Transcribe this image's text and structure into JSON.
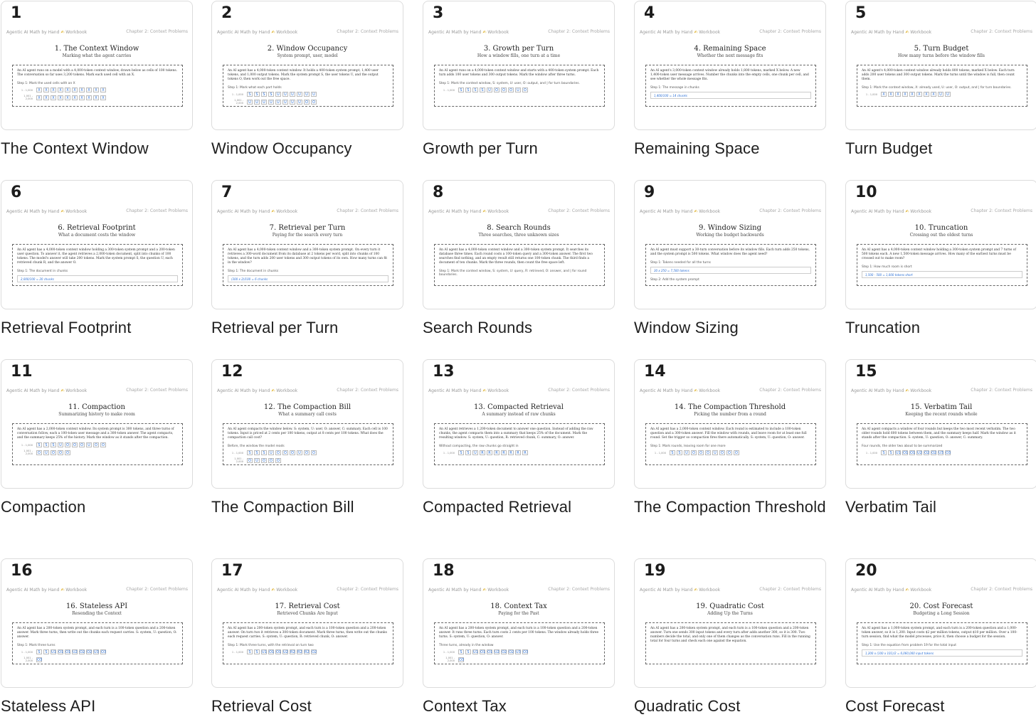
{
  "page_header": {
    "left": "Agentic AI Math by Hand",
    "pen": "✍",
    "workbook": "Workbook",
    "right": "Chapter 2: Context Problems"
  },
  "cards": [
    {
      "num": "1",
      "label": "The Context Window",
      "title": "1. The Context Window",
      "subtitle": "Marking what the agent carries",
      "text": "An AI agent runs on a model with a 4,000-token context window, drawn below as cells of 100 tokens. The conversation so far uses 3,200 tokens. Mark each used cell with an X.",
      "step": "Step 1: Mark the used cells with an X",
      "rows": [
        {
          "r": "1 - 1,000",
          "cells": [
            "X",
            "X",
            "X",
            "X",
            "X",
            "X",
            "X",
            "X",
            "X",
            "X"
          ]
        },
        {
          "r": "1,001 - 2,000",
          "cells": [
            "X",
            "X",
            "X",
            "X",
            "X",
            "X",
            "X",
            "X",
            "X",
            "X"
          ]
        }
      ],
      "answer": ""
    },
    {
      "num": "2",
      "label": "Window Occupancy",
      "title": "2. Window Occupancy",
      "subtitle": "System prompt, user, model",
      "text": "An AI agent has a 4,000-token context window. It holds a 400-token system prompt, 1,400 user tokens, and 1,000 output tokens. Mark the system prompt S, the user tokens U, and the output tokens O, then work out the free space.",
      "step": "Step 1: Mark what each part holds",
      "rows": [
        {
          "r": "1 - 1,000",
          "cells": [
            "S",
            "S",
            "S",
            "S",
            "U",
            "U",
            "U",
            "U",
            "U",
            "U"
          ]
        },
        {
          "r": "1,001 - 2,000",
          "cells": [
            "U",
            "U",
            "U",
            "U",
            "U",
            "U",
            "U",
            "U",
            "O",
            "O"
          ]
        }
      ],
      "answer": ""
    },
    {
      "num": "3",
      "label": "Growth per Turn",
      "title": "3. Growth per Turn",
      "subtitle": "How a window fills, one turn at a time",
      "text": "An AI agent runs on a 4,000-token context window and starts with a 400-token system prompt. Each turn adds 100 user tokens and 300 output tokens. Mark the window after three turns.",
      "step": "Step 1: Mark the context window, S: system, U: user, O: output, and | for turn boundaries.",
      "rows": [
        {
          "r": "1 - 1,000",
          "cells": [
            "S",
            "S",
            "S",
            "S",
            "U",
            "O",
            "O",
            "O",
            "U",
            "O"
          ]
        }
      ],
      "answer": ""
    },
    {
      "num": "4",
      "label": "Remaining Space",
      "title": "4. Remaining Space",
      "subtitle": "Whether the next message fits",
      "text": "An AI agent's 3,000-token context window already holds 1,800 tokens, marked X below. A new 1,400-token user message arrives. Number the chunks into the empty cells, one chunk per cell, and see whether the whole message fits.",
      "step": "Step 1: The message in chunks",
      "rows": [],
      "answer": "1,400/100 = 14 chunks"
    },
    {
      "num": "5",
      "label": "Turn Budget",
      "title": "5. Turn Budget",
      "subtitle": "How many turns before the window fills",
      "text": "An AI agent's 4,000-token context window already holds 800 tokens, marked X below. Each turn adds 200 user tokens and 300 output tokens. Mark the turns until the window is full, then count them.",
      "step": "Step 1: Mark the context window, X: already used, U: user, O: output, and | for turn boundaries.",
      "rows": [
        {
          "r": "1 - 1,000",
          "cells": [
            "X",
            "X",
            "X",
            "X",
            "X",
            "X",
            "X",
            "X",
            "U",
            "U"
          ]
        }
      ],
      "answer": ""
    },
    {
      "num": "6",
      "label": "Retrieval Footprint",
      "title": "6. Retrieval Footprint",
      "subtitle": "What a document costs the window",
      "text": "An AI agent has a 4,000-token context window holding a 300-token system prompt and a 200-token user question. To answer it, the agent retrieves a 2,000-token document, split into chunks of 100 tokens. The model's answer will take 200 tokens. Mark the system prompt S, the question U, each retrieved chunk R, and the answer O.",
      "step": "Step 1: The document in chunks",
      "rows": [],
      "answer": "2,000/100 = 20 chunks"
    },
    {
      "num": "7",
      "label": "Retrieval per Turn",
      "title": "7. Retrieval per Turn",
      "subtitle": "Paying for the search every turn",
      "text": "An AI agent has a 4,000-token context window and a 300-token system prompt. On every turn it retrieves a 300-word document from its database at 2 tokens per word, split into chunks of 100 tokens, and the turn adds 200 user tokens and 300 output tokens of its own. How many turns can fit in the window?",
      "step": "Step 1: The document in chunks",
      "rows": [],
      "answer": "(300 x 2)/100 = 6 chunks"
    },
    {
      "num": "8",
      "label": "Search Rounds",
      "title": "8. Search Rounds",
      "subtitle": "Three searches, three unknown sizes",
      "text": "An AI agent has a 4,000-token context window and a 300-token system prompt. It searches its database three times. Each round costs a 100-token query and a 300-token answer. The first two searches find nothing, and an empty result still returns one 100-token chunk. The third finds a document of ten chunks. Mark the three rounds, then count the free space left.",
      "step": "Step 1: Mark the context window, S: system, U: query, R: retrieved, O: answer, and | for round boundaries.",
      "rows": [],
      "answer": ""
    },
    {
      "num": "9",
      "label": "Window Sizing",
      "title": "9. Window Sizing",
      "subtitle": "Working the budget backwards",
      "text": "An AI agent must support a 30-turn conversation before its window fills. Each turn adds 250 tokens, and the system prompt is 500 tokens. What window does the agent need?",
      "step": "Step 1: Tokens needed for all the turns",
      "rows": [],
      "answer": "30 x 250 = 7,500 tokens",
      "step2": "Step 2: Add the system prompt"
    },
    {
      "num": "10",
      "label": "Truncation",
      "title": "10. Truncation",
      "subtitle": "Crossing out the oldest turns",
      "text": "An AI agent has a 4,000-token context window holding a 300-token system prompt and 7 turns of 500 tokens each. A new 1,500-token message arrives. How many of the earliest turns must be crossed out to make room?",
      "step": "Step 1: How much room is short",
      "rows": [],
      "answer": "1,500 - 500 = 1,000 tokens short"
    },
    {
      "num": "11",
      "label": "Compaction",
      "title": "11. Compaction",
      "subtitle": "Summarizing history to make room",
      "text": "An AI agent has a 2,000-token context window. Its system prompt is 300 tokens, and three turns of conversation follow, each a 100-token user message and a 300-token answer. The agent compacts, and the summary keeps 25% of the history. Mark the window as it stands after the compaction.",
      "step": "",
      "rows": [
        {
          "r": "1 - 1,000",
          "cells": [
            "S",
            "S",
            "S",
            "U",
            "O",
            "O",
            "O",
            "U",
            "O",
            "O"
          ]
        },
        {
          "r": "1,001 - 2,000",
          "cells": [
            "O",
            "U",
            "O",
            "O",
            "O"
          ]
        }
      ],
      "answer": ""
    },
    {
      "num": "12",
      "label": "The Compaction Bill",
      "title": "12. The Compaction Bill",
      "subtitle": "What a summary call costs",
      "text": "An AI agent compacts the window below. S: system, U: user, O: answer, C: summary. Each cell is 100 tokens. Input is priced at 2 cents per 100 tokens, output at 8 cents per 100 tokens. What does the compaction call cost?",
      "step": "Before, the window the model reads",
      "rows": [
        {
          "r": "1 - 1,000",
          "cells": [
            "S",
            "S",
            "S",
            "U",
            "O",
            "O",
            "O",
            "U",
            "O",
            "O"
          ]
        },
        {
          "r": "1,001 - 2,000",
          "cells": [
            "O",
            "U",
            "O",
            "O",
            "O"
          ]
        }
      ],
      "answer": ""
    },
    {
      "num": "13",
      "label": "Compacted Retrieval",
      "title": "13. Compacted Retrieval",
      "subtitle": "A summary instead of raw chunks",
      "text": "An AI agent retrieves a 1,200-token document to answer one question. Instead of adding the raw chunks, the agent compacts them into a summary that keeps 25% of the document. Mark the resulting window. S: system, U: question, R: retrieved chunk, C: summary, O: answer.",
      "step": "Without compacting, the raw chunks go straight in",
      "rows": [
        {
          "r": "1 - 1,000",
          "cells": [
            "S",
            "S",
            "U",
            "R",
            "R",
            "R",
            "R",
            "R",
            "R",
            "R"
          ]
        }
      ],
      "answer": ""
    },
    {
      "num": "14",
      "label": "The Compaction Threshold",
      "title": "14. The Compaction Threshold",
      "subtitle": "Picking the number from a round",
      "text": "An AI agent has a 2,000-token context window. Each round is estimated to include a 100-token question and a 300-token answer. Fill the window with rounds, and leave room for at least one full round. Set the trigger so compaction fires there automatically. S: system, U: question, O: answer.",
      "step": "Step 1: Mark rounds, leaving room for one more",
      "rows": [
        {
          "r": "1 - 1,000",
          "cells": [
            "S",
            "S",
            "U",
            "O",
            "O",
            "O",
            "U",
            "O",
            "O",
            "O"
          ]
        }
      ],
      "answer": ""
    },
    {
      "num": "15",
      "label": "Verbatim Tail",
      "title": "15. Verbatim Tail",
      "subtitle": "Keeping the recent rounds whole",
      "text": "An AI agent compacts a window of four rounds but keeps the two most recent verbatim. The two older rounds hold 600 tokens between them, and the summary keeps half. Mark the window as it stands after the compaction. S: system, U: question, O: answer, C: summary.",
      "step": "Four rounds, the older two about to be summarized",
      "rows": [
        {
          "r": "1 - 1,000",
          "cells": [
            "S",
            "S",
            "U1",
            "O1",
            "O1",
            "U2",
            "O2",
            "O2",
            "U3",
            "O3"
          ]
        }
      ],
      "answer": ""
    },
    {
      "num": "16",
      "label": "Stateless API",
      "title": "16. Stateless API",
      "subtitle": "Resending the Context",
      "text": "An AI agent has a 200-token system prompt, and each turn is a 100-token question and a 200-token answer. Mark three turns, then write out the chunks each request carries. S: system, U: question, O: answer.",
      "step": "Step 1: Mark three turns",
      "rows": [
        {
          "r": "1 - 1,000",
          "cells": [
            "S",
            "S",
            "U1",
            "O1",
            "O1",
            "U2",
            "O2",
            "O2",
            "U3",
            "O3"
          ]
        },
        {
          "r": "1,001 - 2,000",
          "cells": [
            "O3"
          ]
        }
      ],
      "answer": ""
    },
    {
      "num": "17",
      "label": "Retrieval Cost",
      "title": "17. Retrieval Cost",
      "subtitle": "Retrieved Chunks Are Input",
      "text": "An AI agent has a 200-token system prompt, and each turn is a 100-token question and a 200-token answer. On turn two it retrieves a 300-token document. Mark three turns, then write out the chunks each request carries. S: system, U: question, R: retrieved chunk, O: answer.",
      "step": "Step 1: Mark three turns, with the retrieval on turn two",
      "rows": [
        {
          "r": "1 - 1,000",
          "cells": [
            "S",
            "S",
            "U1",
            "O1",
            "O1",
            "U2",
            "R2",
            "R2",
            "R2",
            "O2"
          ]
        }
      ],
      "answer": ""
    },
    {
      "num": "18",
      "label": "Context Tax",
      "title": "18. Context Tax",
      "subtitle": "Paying for the Past",
      "text": "An AI agent has a 200-token system prompt, and each turn is a 100-token question and a 200-token answer. It runs three turns. Each turn costs 2 cents per 100 tokens. The window already holds three turns. S: system, U: question, O: answer.",
      "step": "Three turns, already in the window",
      "rows": [
        {
          "r": "1 - 1,000",
          "cells": [
            "S",
            "S",
            "U1",
            "O1",
            "O1",
            "U2",
            "O2",
            "O2",
            "U3",
            "O3"
          ]
        },
        {
          "r": "1,001 - 2,000",
          "cells": [
            "O3"
          ]
        }
      ],
      "answer": ""
    },
    {
      "num": "19",
      "label": "Quadratic Cost",
      "title": "19. Quadratic Cost",
      "subtitle": "Adding Up the Turns",
      "text": "An AI agent has a 200-token system prompt, and each turn is a 100-token question and a 200-token answer. Turn one sends 300 input tokens and every turn after adds another 300, so it is 300. Two numbers decide the total, and only one of them changes as the conversation runs. Fill in the running total for four turns and check each one against the equation.",
      "step": "",
      "rows": [],
      "answer": ""
    },
    {
      "num": "20",
      "label": "Cost Forecast",
      "title": "20. Cost Forecast",
      "subtitle": "Budgeting a Long Session",
      "text": "An AI agent has a 1,000-token system prompt, and each turn is a 200-token question and a 1,000-token answer, so it is 1,200. Input costs $2 per million tokens, output $10 per million. Over a 100-turn session, find what the model processes, price it, then choose a budget for the session.",
      "step": "Step 1: Use the equation from problem 19 for the total input",
      "rows": [],
      "answer": "1,200 x (100 x 101)/2 = 6,060,000 input tokens"
    }
  ]
}
